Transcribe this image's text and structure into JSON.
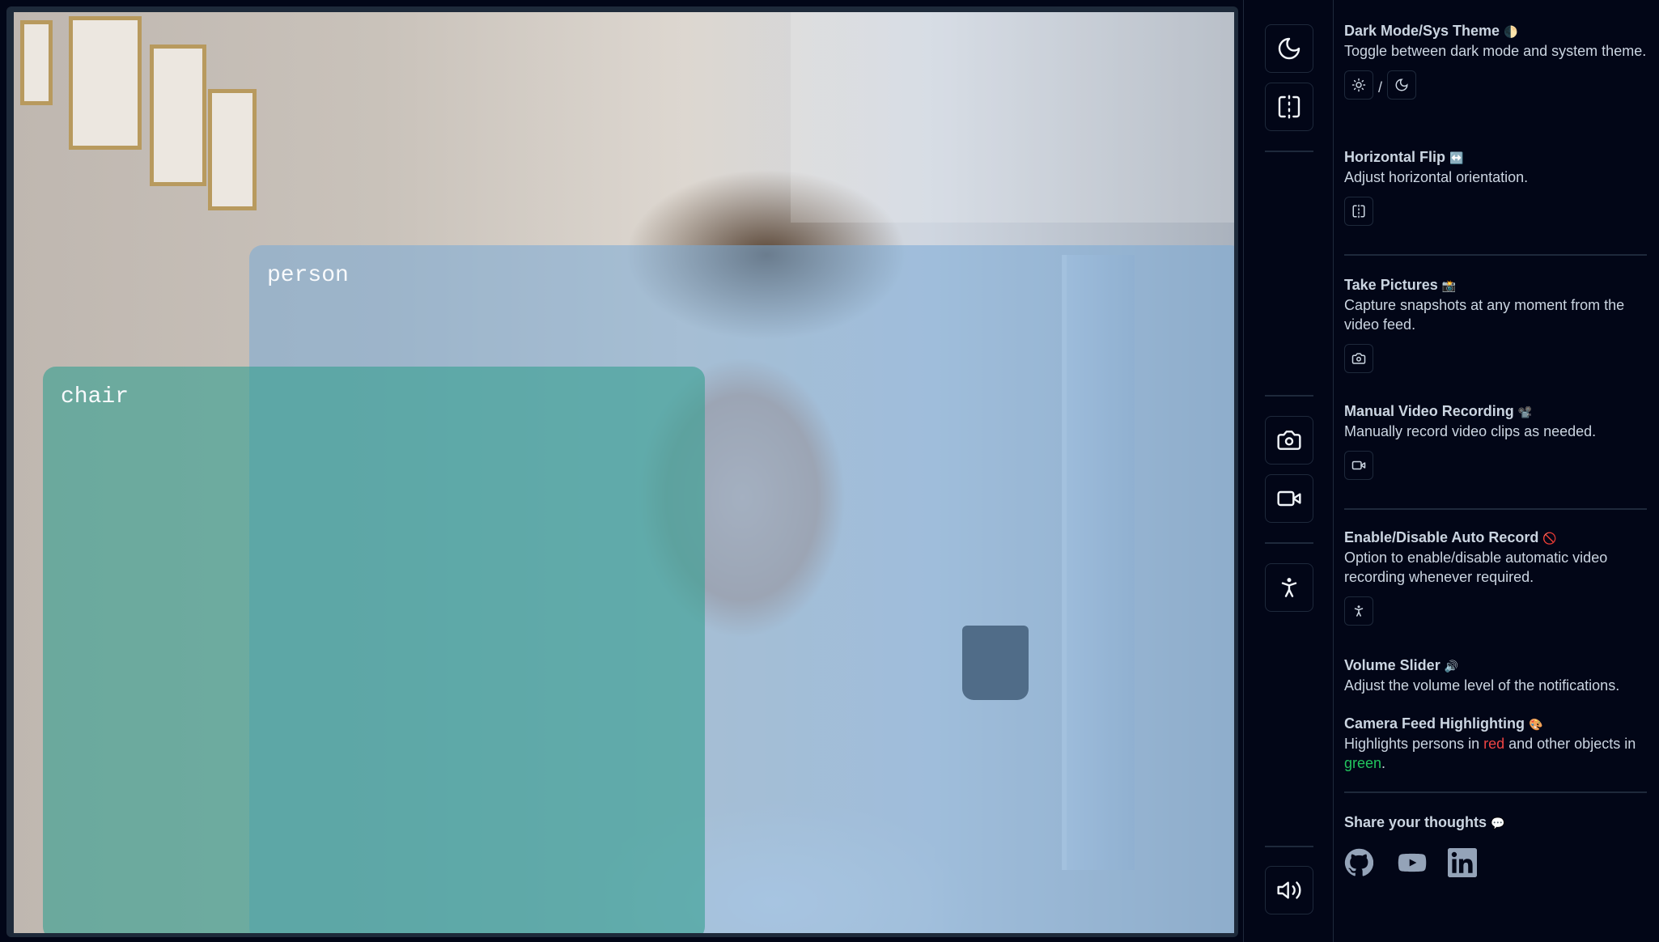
{
  "detections": [
    {
      "label": "person"
    },
    {
      "label": "chair"
    }
  ],
  "toolbar": {
    "buttons": [
      {
        "name": "theme-toggle-button",
        "icon": "moon-icon"
      },
      {
        "name": "flip-button",
        "icon": "flip-horizontal-icon"
      },
      {
        "name": "take-picture-button",
        "icon": "camera-icon"
      },
      {
        "name": "record-video-button",
        "icon": "video-icon"
      },
      {
        "name": "auto-record-button",
        "icon": "person-standing-icon"
      },
      {
        "name": "volume-button",
        "icon": "volume-icon"
      }
    ]
  },
  "help": {
    "theme": {
      "title": "Dark Mode/Sys Theme",
      "emoji": "🌓",
      "desc": "Toggle between dark mode and system theme.",
      "separator": "/"
    },
    "flip": {
      "title": "Horizontal Flip",
      "emoji": "↔️",
      "desc": "Adjust horizontal orientation."
    },
    "pictures": {
      "title": "Take Pictures",
      "emoji": "📸",
      "desc": "Capture snapshots at any moment from the video feed."
    },
    "recording": {
      "title": "Manual Video Recording",
      "emoji": "📽️",
      "desc": "Manually record video clips as needed."
    },
    "auto_record": {
      "title": "Enable/Disable Auto Record",
      "emoji": "🚫",
      "desc": "Option to enable/disable automatic video recording whenever required."
    },
    "volume": {
      "title": "Volume Slider",
      "emoji": "🔊",
      "desc": "Adjust the volume level of the notifications."
    },
    "highlight": {
      "title": "Camera Feed Highlighting",
      "emoji": "🎨",
      "desc_1": "Highlights persons in ",
      "red_word": "red",
      "desc_2": " and other objects in ",
      "green_word": "green",
      "desc_3": "."
    },
    "share": {
      "title": "Share your thoughts",
      "emoji": "💬"
    }
  },
  "social": [
    "github-icon",
    "youtube-icon",
    "linkedin-icon"
  ],
  "colors": {
    "person_box": "#78aad7",
    "chair_box": "#37a091",
    "highlight_red": "#ef4444",
    "highlight_green": "#22c55e",
    "background": "#020617"
  }
}
